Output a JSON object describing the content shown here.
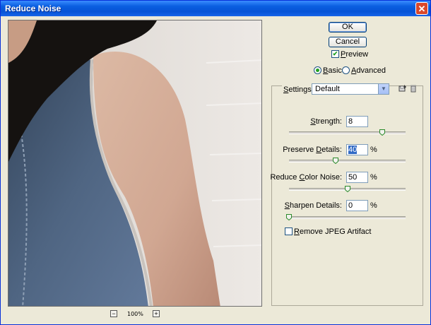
{
  "window": {
    "title": "Reduce Noise",
    "close_glyph": "✕"
  },
  "buttons": {
    "ok": "OK",
    "cancel": "Cancel"
  },
  "preview_checkbox": {
    "label_u": "P",
    "label_rest": "review",
    "checked": true
  },
  "mode": {
    "basic_u": "B",
    "basic_rest": "asic",
    "advanced_u": "A",
    "advanced_rest": "dvanced",
    "selected": "basic"
  },
  "settings": {
    "label_u": "S",
    "label_rest": "ettings:",
    "value": "Default"
  },
  "controls": [
    {
      "label_pre": "",
      "label_u": "S",
      "label_post": "trength:",
      "value": "8",
      "unit": "",
      "fraction": 0.8
    },
    {
      "label_pre": "Preserve ",
      "label_u": "D",
      "label_post": "etails:",
      "value": "40",
      "unit": "%",
      "fraction": 0.4
    },
    {
      "label_pre": "Reduce ",
      "label_u": "C",
      "label_post": "olor Noise:",
      "value": "50",
      "unit": "%",
      "fraction": 0.5
    },
    {
      "label_pre": "",
      "label_u": "S",
      "label_post": "harpen Details:",
      "value": "0",
      "unit": "%",
      "fraction": 0.0
    }
  ],
  "remove_jpeg": {
    "label_u": "R",
    "label_rest": "emove JPEG Artifact",
    "checked": false
  },
  "zoom": {
    "level": "100%",
    "minus": "−",
    "plus": "+"
  },
  "icons": {
    "save_settings": "save-settings-icon",
    "delete_settings": "trash-icon",
    "dropdown_arrow": "chevron-down-icon"
  }
}
